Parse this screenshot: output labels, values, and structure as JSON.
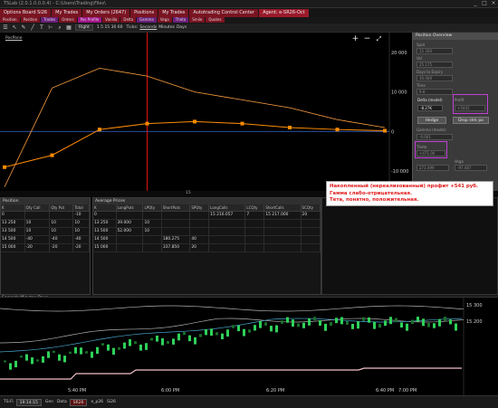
{
  "window": {
    "title": "TSLab (2.0.1.0.0.0.4) - C:\\Users\\Trading\\Files\\",
    "controls": [
      "_",
      "□",
      "×"
    ]
  },
  "tabs": [
    {
      "label": "Options Board Si26",
      "color": "#7a1422"
    },
    {
      "label": "My Trades",
      "color": "#7a1422"
    },
    {
      "label": "My Orders (2647)",
      "color": "#7a1422"
    },
    {
      "label": "Positions",
      "color": "#7a1422"
    },
    {
      "label": "My Trades",
      "color": "#7a1422"
    },
    {
      "label": "Autotrading Control Center",
      "color": "#7a1422"
    },
    {
      "label": "Agent: e-SR26-Oct",
      "color": "#9a1a2a"
    }
  ],
  "subtabs": [
    {
      "label": "Position",
      "color": "#7a1422"
    },
    {
      "label": "Position",
      "color": "#7a1422"
    },
    {
      "label": "Trades",
      "color": "#6a1f7a"
    },
    {
      "label": "Orders",
      "color": "#7a1422"
    },
    {
      "label": "Pos Profile",
      "color": "#a0148a"
    },
    {
      "label": "Vanilla",
      "color": "#7a1422"
    },
    {
      "label": "Delta",
      "color": "#7a1422"
    },
    {
      "label": "Gamma",
      "color": "#6a1f7a"
    },
    {
      "label": "Vega",
      "color": "#7a1422"
    },
    {
      "label": "Theta",
      "color": "#6a1f7a"
    },
    {
      "label": "Smile",
      "color": "#7a1422"
    },
    {
      "label": "Quotes",
      "color": "#7a1422"
    }
  ],
  "toolbar": {
    "icons": [
      "cursor-icon",
      "crosshair-icon",
      "pencil-icon",
      "line-icon",
      "text-icon",
      "ruler-icon",
      "zoom-icon",
      "grid-icon"
    ],
    "dropdown": "Right",
    "intervals": "1 5 15 30 60",
    "ticks_label": "Ticks:",
    "ticks_value": "Seconds",
    "minutes": "Minutes",
    "days": "Days"
  },
  "chart": {
    "label": "PosPane",
    "zoom_in": "+",
    "zoom_out": "−",
    "fit": "⤢",
    "axis_marker": "15"
  },
  "chart_data": {
    "type": "line",
    "x": [
      13500,
      14000,
      14500,
      15000,
      15500,
      16000,
      16500,
      17000,
      17500
    ],
    "series": [
      {
        "values": [
          -9000,
          -6000,
          500,
          2000,
          2500,
          2000,
          1000,
          500,
          200
        ],
        "color": "#ff8c00"
      },
      {
        "values": [
          -14000,
          11000,
          16000,
          14000,
          10000,
          8000,
          6000,
          3000,
          1000
        ],
        "color": "#ffa040"
      }
    ],
    "ylim": [
      -15000,
      25000
    ],
    "yticks": [
      "20 000",
      "10 000",
      "0",
      "-10 000"
    ],
    "vline_x": 15000
  },
  "rpanel": {
    "title": "Position Overview",
    "fields": [
      {
        "label": "Spot",
        "value": "15 200"
      },
      {
        "label": "Vol",
        "value": "25.175"
      },
      {
        "label": "Days to Expiry",
        "value": "30.000"
      },
      {
        "label": "Time",
        "value": "9.8"
      }
    ],
    "delta_label": "Delta (model)",
    "delta_value": "-8.27K",
    "profit_label": "Profit",
    "profit_value": "+5441",
    "hedge": "Hedge",
    "drop_otm": "Drop strk po",
    "gamma_label": "Gamma (model)",
    "gamma_value": "-0.001",
    "theta_label": "Theta",
    "theta_value": "+471.00",
    "vega_label": "Vega",
    "vega_value": "-97.487",
    "extra_left": "271.499"
  },
  "note": {
    "lines": [
      "Накопленный (нереализованный) профит +541 руб.",
      "Гамма слабо-отрицательная.",
      "Тета, понятно, положительная."
    ]
  },
  "position_table": {
    "title": "Position",
    "columns": [
      "K",
      "Qty Call",
      "Qty Put",
      "Total"
    ],
    "rows": [
      [
        "0",
        "",
        "",
        "-10"
      ],
      [
        "13 250",
        "10",
        "10",
        "10"
      ],
      [
        "13 500",
        "10",
        "10",
        "10"
      ],
      [
        "14 500",
        "-40",
        "-40",
        "-40"
      ],
      [
        "15 000",
        "-20",
        "-20",
        "-20"
      ]
    ]
  },
  "prices_table": {
    "title": "Average Prices",
    "columns": [
      "K",
      "LongPuts",
      "LPQty",
      "ShortPuts",
      "SPQty",
      "LongCalls",
      "LCQty",
      "ShortCalls",
      "SCQty"
    ],
    "rows": [
      [
        "0",
        "",
        "",
        "",
        "",
        "15 216.057",
        "7",
        "15 217.000",
        "20"
      ],
      [
        "13 250",
        "39.000",
        "10",
        "",
        "",
        "",
        "",
        "",
        ""
      ],
      [
        "13 500",
        "52.000",
        "10",
        "",
        "",
        "",
        "",
        "",
        ""
      ],
      [
        "14 500",
        "",
        "",
        "180.275",
        "40",
        "",
        "",
        "",
        ""
      ],
      [
        "15 000",
        "",
        "",
        "337.850",
        "20",
        "",
        "",
        "",
        ""
      ]
    ]
  },
  "bottom": {
    "header": "Seconds  Minutes  Days",
    "price_hi": "15 300",
    "price_lo": "15 200",
    "times": [
      "5:40 PM",
      "6:00 PM",
      "6:20 PM",
      "6:40 PM",
      "7:00 PM"
    ]
  },
  "status": {
    "time_label": "TS:Fi",
    "time": "19:14:15",
    "gen": "Gen",
    "data": "Data",
    "ticker": "SR26",
    "bp": "e_p26",
    "ticker2": "Si26"
  }
}
